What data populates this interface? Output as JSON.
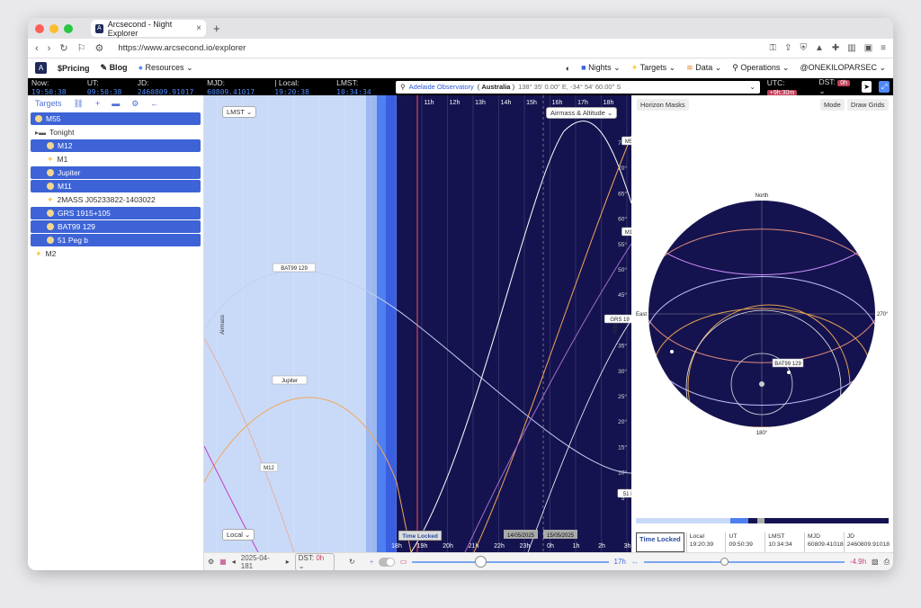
{
  "browser": {
    "tab_title": "Arcsecond - Night Explorer",
    "url": "https://www.arcsecond.io/explorer"
  },
  "nav": {
    "pricing": "$Pricing",
    "blog": "Blog",
    "resources": "Resources",
    "nights": "Nights",
    "targets": "Targets",
    "data": "Data",
    "operations": "Operations",
    "user": "@ONEKILOPARSEC"
  },
  "status": {
    "now_label": "Now:",
    "now": "19:50:38",
    "ut_label": "UT:",
    "ut": "09:50:38",
    "jd_label": "JD:",
    "jd": "2460809.91017",
    "mjd_label": "MJD:",
    "mjd": "60809.41017",
    "local_label": "Local:",
    "local": "19:20:38",
    "lmst_label": "LMST:",
    "lmst": "10:34:34",
    "observatory": "Adelaide Observatory",
    "country": "Australia",
    "coords": "138° 35' 0.00\" E, -34° 54' 60.00\" S",
    "utc_label": "UTC:",
    "utc_offset": "+9h:30m",
    "dst_label": "DST:",
    "dst": "0h"
  },
  "sidebar": {
    "title": "Targets",
    "items": [
      {
        "label": "M55",
        "type": "moon",
        "selected": true,
        "indent": false
      },
      {
        "label": "Tonight",
        "type": "folder",
        "selected": false,
        "indent": false
      },
      {
        "label": "M12",
        "type": "moon",
        "selected": true,
        "indent": true
      },
      {
        "label": "M1",
        "type": "star",
        "selected": false,
        "indent": true
      },
      {
        "label": "Jupiter",
        "type": "moon",
        "selected": true,
        "indent": true
      },
      {
        "label": "M11",
        "type": "moon",
        "selected": true,
        "indent": true
      },
      {
        "label": "2MASS J05233822-1403022",
        "type": "star",
        "selected": false,
        "indent": true
      },
      {
        "label": "GRS 1915+105",
        "type": "moon",
        "selected": true,
        "indent": true
      },
      {
        "label": "BAT99 129",
        "type": "moon",
        "selected": true,
        "indent": true
      },
      {
        "label": "51 Peg b",
        "type": "moon",
        "selected": true,
        "indent": true
      },
      {
        "label": "M2",
        "type": "star",
        "selected": false,
        "indent": false
      }
    ]
  },
  "chart": {
    "top_axis_select": "LMST",
    "bottom_axis_select": "Local",
    "mode_select": "Airmass & Altitude",
    "left_axis_label": "Airmass",
    "right_axis_label": "Altitude",
    "top_ticks": [
      "11h",
      "12h",
      "13h",
      "14h",
      "15h",
      "16h",
      "17h",
      "18h"
    ],
    "bottom_ticks": [
      "18h",
      "19h",
      "20h",
      "21h",
      "22h",
      "23h",
      "0h",
      "1h",
      "2h",
      "3h"
    ],
    "alt_ticks": [
      "75°",
      "70°",
      "65°",
      "60°",
      "55°",
      "50°",
      "45°",
      "40°",
      "35°",
      "30°",
      "25°",
      "20°",
      "15°",
      "10°",
      "5°"
    ],
    "date_left": "14/05/2025",
    "date_right": "15/05/2025",
    "time_locked": "Time Locked",
    "labels": [
      "BAT99 129",
      "Jupiter",
      "M12",
      "M5",
      "M1",
      "GRS 19",
      "51 P"
    ]
  },
  "sky": {
    "horizon_masks": "Horizon Masks",
    "mode": "Mode",
    "draw_grids": "Draw Grids",
    "north": "North",
    "east": "East",
    "west": "270°",
    "south": "180°",
    "target_label": "BAT99 129"
  },
  "info": {
    "time_locked": "Time Locked",
    "local_label": "Local",
    "local": "19:20:39",
    "ut_label": "UT",
    "ut": "09:50:39",
    "lmst_label": "LMST",
    "lmst": "10:34:34",
    "mjd_label": "MJD",
    "mjd": "60809.41018",
    "jd_label": "JD",
    "jd": "2460809.91018"
  },
  "bottom": {
    "date": "2025-04-181",
    "dst_label": "DST:",
    "dst": "0h",
    "span": "17h",
    "offset": "-4.9h"
  },
  "colors": {
    "accent": "#3d63d6",
    "night": "#15134f",
    "day": "#c9daf8"
  }
}
